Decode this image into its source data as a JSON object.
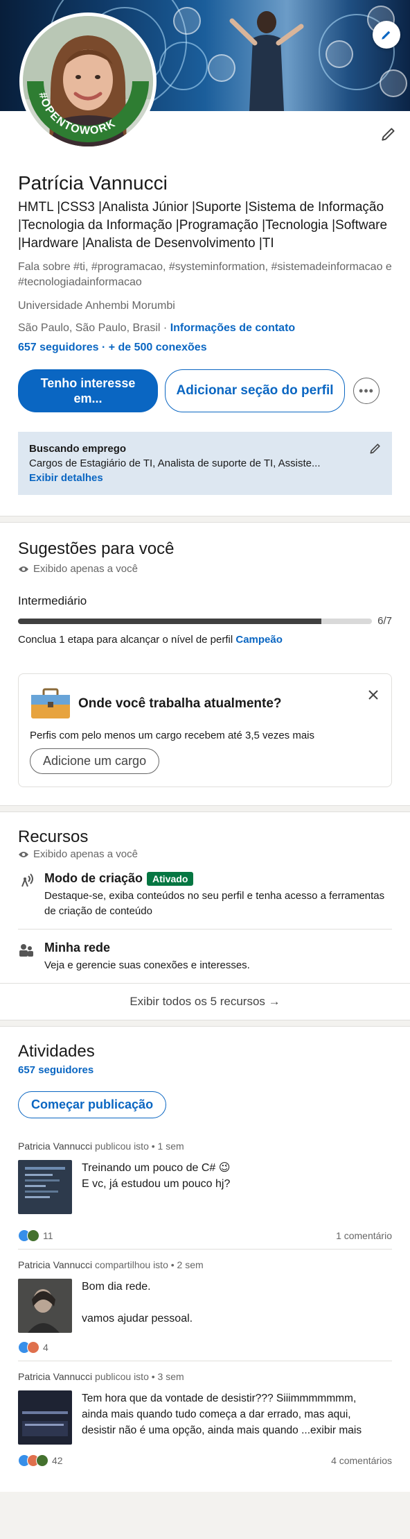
{
  "profile": {
    "name": "Patrícia Vannucci",
    "headline": "HMTL |CSS3 |Analista Júnior |Suporte |Sistema de Informação |Tecnologia da Informação |Programação |Tecnologia |Software |Hardware |Analista de Desenvolvimento |TI",
    "about_topics": "Fala sobre #ti, #programacao, #systeminformation, #sistemadeinformacao e #tecnologiadainformacao",
    "school": "Universidade Anhembi Morumbi",
    "location": "São Paulo, São Paulo, Brasil ·",
    "contact_link": "Informações de contato",
    "followers": "657 seguidores",
    "connections": "· + de 500 conexões",
    "avatar_badge": "#OPENTOWORK",
    "btn_interest_line1": "Tenho interesse",
    "btn_interest_line2": "em...",
    "btn_add_section": "Adicionar seção do perfil",
    "btn_more": "•••",
    "open_to_work": {
      "title": "Buscando emprego",
      "desc": "Cargos de Estagiário de TI, Analista de suporte de TI, Assiste...",
      "link": "Exibir detalhes"
    }
  },
  "suggestions": {
    "title": "Sugestões para você",
    "private": "Exibido apenas a você",
    "level": "Intermediário",
    "progress_value": 6,
    "progress_max": 7,
    "progress_label": "6/7",
    "note_prefix": "Conclua 1 etapa para alcançar o nível de perfil",
    "note_link": "Campeão",
    "card": {
      "question": "Onde você trabalha atualmente?",
      "text": "Perfis com pelo menos um cargo recebem até 3,5 vezes mais",
      "button": "Adicione um cargo"
    }
  },
  "resources": {
    "title": "Recursos",
    "private": "Exibido apenas a você",
    "items": [
      {
        "title": "Modo de criação",
        "badge": "Ativado",
        "desc": "Destaque-se, exiba conteúdos no seu perfil e tenha acesso a ferramentas de criação de conteúdo"
      },
      {
        "title": "Minha rede",
        "badge": "",
        "desc": "Veja e gerencie suas conexões e interesses."
      }
    ],
    "show_all": "Exibir todos os 5 recursos →"
  },
  "activity": {
    "title": "Atividades",
    "followers": "657 seguidores",
    "start_post": "Começar publicação",
    "posts": [
      {
        "author": "Patricia Vannucci",
        "meta": "publicou isto • 1 sem",
        "line1": "Treinando um pouco de C# 😉",
        "line2": "E vc, já estudou um pouco hj?",
        "line3": "",
        "reactions": "11",
        "comments": "1 comentário"
      },
      {
        "author": "Patricia Vannucci",
        "meta": "compartilhou isto • 2 sem",
        "line1": "Bom dia rede.",
        "line2": "",
        "line3": "vamos ajudar pessoal.",
        "reactions": "4",
        "comments": ""
      },
      {
        "author": "Patricia Vannucci",
        "meta": "publicou isto • 3 sem",
        "line1": "Tem hora que da vontade de desistir??? Siiimmmmmmm,",
        "line2": "ainda mais quando tudo começa a dar errado, mas aqui,",
        "line3": "desistir não é uma opção, ainda mais quando ...exibir mais",
        "reactions": "42",
        "comments": "4 comentários"
      }
    ]
  },
  "colors": {
    "accent": "#0a66c2",
    "badge_green": "#057642",
    "otw_green": "#2e7d32",
    "otw_bg": "#dde7f1"
  },
  "icons": [
    "pencil-icon",
    "eye-icon",
    "close-icon",
    "briefcase-icon",
    "broadcast-icon",
    "people-icon",
    "arrow-right-icon"
  ]
}
